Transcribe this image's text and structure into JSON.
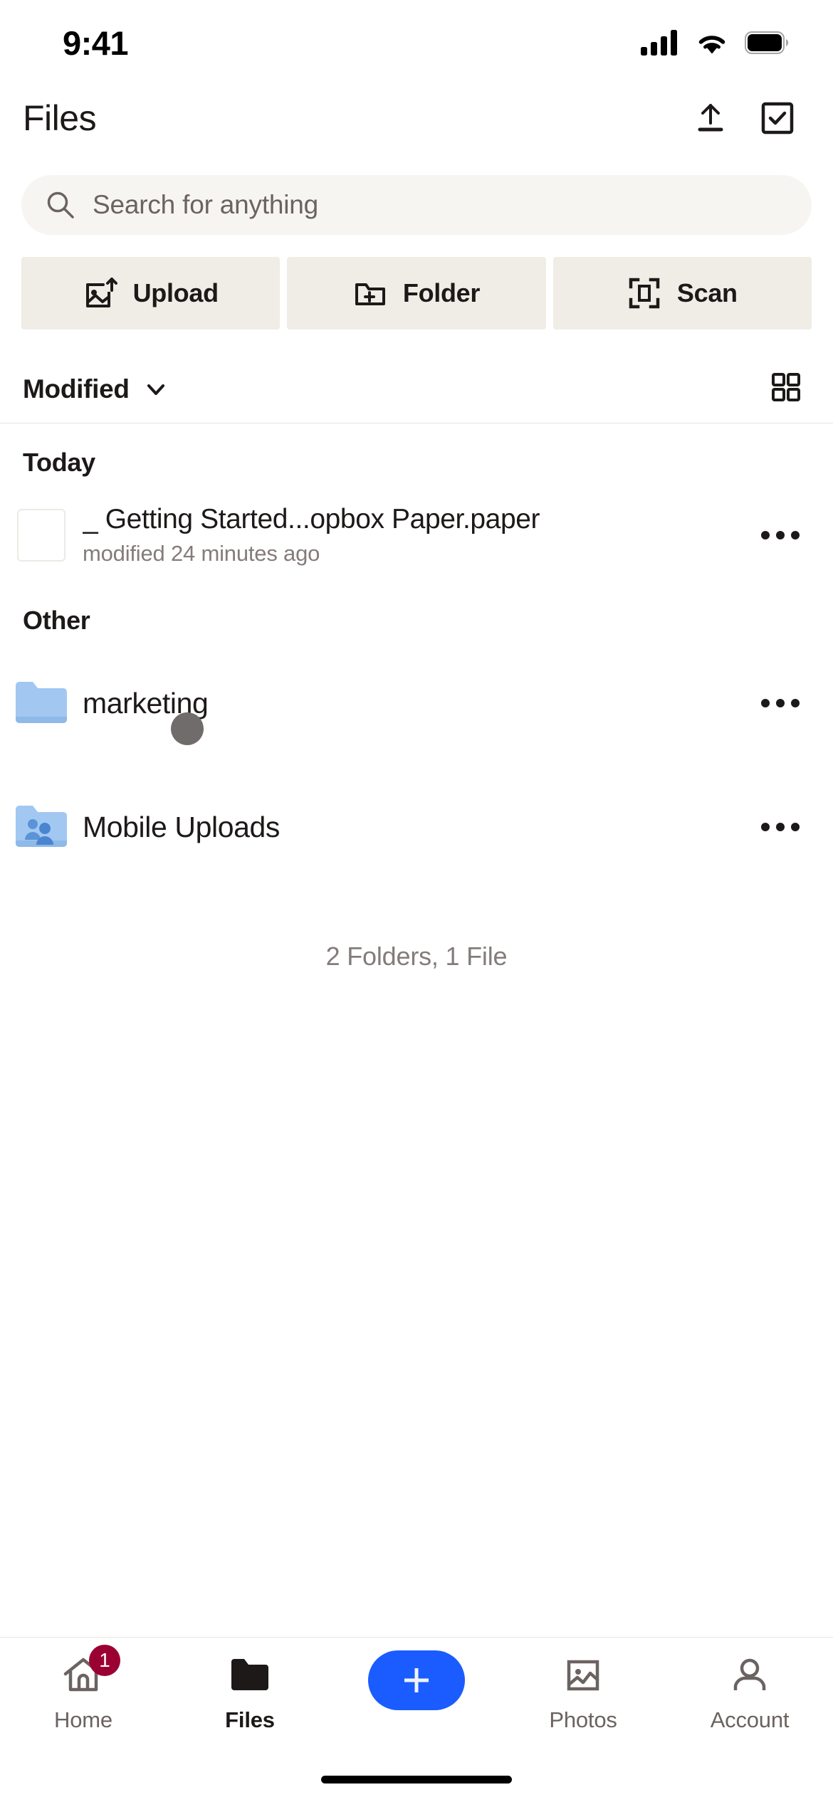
{
  "status_bar": {
    "time": "9:41",
    "icons": [
      "cellular-signal-icon",
      "wifi-icon",
      "battery-icon"
    ]
  },
  "header": {
    "title": "Files",
    "upload_icon": "upload-arrow-icon",
    "select_icon": "checkbox-select-icon"
  },
  "search": {
    "placeholder": "Search for anything",
    "icon": "search-icon"
  },
  "quick_actions": [
    {
      "label": "Upload",
      "icon": "image-upload-icon"
    },
    {
      "label": "Folder",
      "icon": "folder-plus-icon"
    },
    {
      "label": "Scan",
      "icon": "scan-frame-icon"
    }
  ],
  "sort_row": {
    "sort_label": "Modified",
    "chevron_icon": "chevron-down-icon",
    "view_toggle_icon": "grid-view-icon"
  },
  "sections": [
    {
      "heading": "Today",
      "items": [
        {
          "name": "_ Getting Started...opbox Paper.paper",
          "subtitle": "modified 24 minutes ago",
          "type": "paper-file",
          "overflow_icon": "overflow-menu-icon"
        }
      ]
    },
    {
      "heading": "Other",
      "items": [
        {
          "name": "marketing",
          "subtitle": "",
          "type": "folder",
          "overflow_icon": "overflow-menu-icon"
        },
        {
          "name": "Mobile Uploads",
          "subtitle": "",
          "type": "shared-folder",
          "overflow_icon": "overflow-menu-icon"
        }
      ]
    }
  ],
  "list_footer": {
    "count_text": "2 Folders, 1 File"
  },
  "bottom_nav": {
    "items": [
      {
        "label": "Home",
        "icon": "home-icon",
        "active": false,
        "badge": "1"
      },
      {
        "label": "Files",
        "icon": "folder-icon",
        "active": true,
        "badge": ""
      },
      {
        "label": "Photos",
        "icon": "photos-icon",
        "active": false,
        "badge": ""
      },
      {
        "label": "Account",
        "icon": "person-icon",
        "active": false,
        "badge": ""
      }
    ],
    "fab_icon": "plus-icon"
  },
  "colors": {
    "accent_blue": "#1a5cff",
    "badge_red": "#9b0032",
    "quick_action_bg": "#f0ede6",
    "search_bg": "#f7f5f2",
    "folder_blue": "#a2c8f2",
    "text_primary": "#1e1919",
    "text_secondary": "#847c7a"
  }
}
